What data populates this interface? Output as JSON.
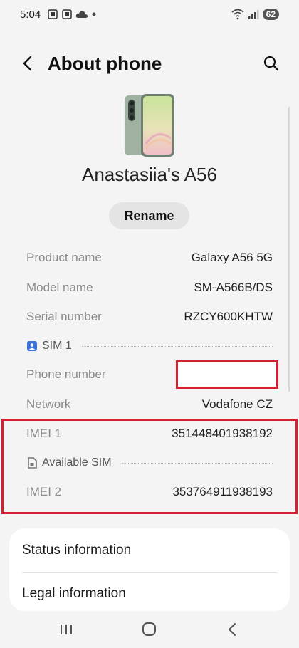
{
  "status_bar": {
    "time": "5:04",
    "battery": "62"
  },
  "header": {
    "title": "About phone"
  },
  "device": {
    "name": "Anastasiia's A56",
    "rename_label": "Rename"
  },
  "info": {
    "product_name": {
      "label": "Product name",
      "value": "Galaxy A56 5G"
    },
    "model_name": {
      "label": "Model name",
      "value": "SM-A566B/DS"
    },
    "serial_number": {
      "label": "Serial number",
      "value": "RZCY600KHTW"
    },
    "sim1_label": "SIM 1",
    "phone_number": {
      "label": "Phone number",
      "value": ""
    },
    "network": {
      "label": "Network",
      "value": "Vodafone CZ"
    },
    "imei1": {
      "label": "IMEI 1",
      "value": "351448401938192"
    },
    "available_sim_label": "Available SIM",
    "imei2": {
      "label": "IMEI 2",
      "value": "353764911938193"
    }
  },
  "card": {
    "status_information": "Status information",
    "legal_information": "Legal information"
  },
  "colors": {
    "highlight_red": "#d42030",
    "sim_icon_blue": "#3b73d9"
  },
  "icons": [
    "back-arrow-icon",
    "search-icon",
    "phone-device-image",
    "sim-card-icon",
    "recent-apps-icon",
    "home-icon",
    "nav-back-icon"
  ]
}
